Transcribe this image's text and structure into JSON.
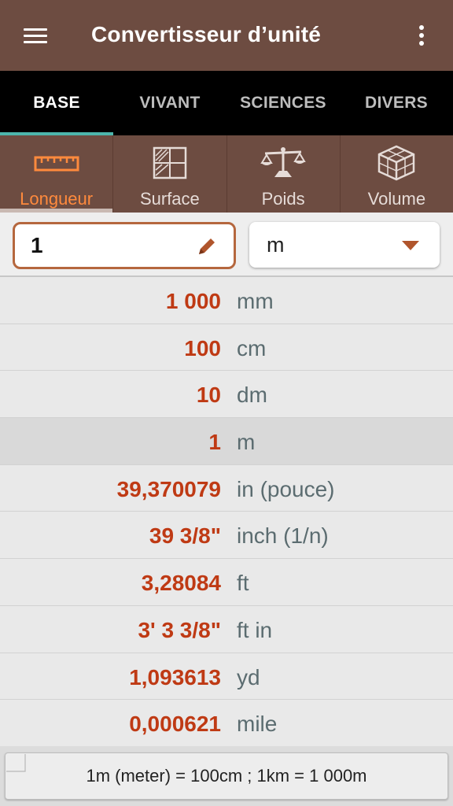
{
  "app": {
    "title": "Convertisseur d’unité",
    "icons": {
      "menu": "hamburger-menu-icon",
      "more": "more-vert-icon"
    }
  },
  "tabs": [
    {
      "label": "BASE",
      "active": true
    },
    {
      "label": "VIVANT",
      "active": false
    },
    {
      "label": "SCIENCES",
      "active": false
    },
    {
      "label": "DIVERS",
      "active": false
    }
  ],
  "categories": [
    {
      "label": "Longueur",
      "icon": "ruler-icon",
      "active": true
    },
    {
      "label": "Surface",
      "icon": "surface-grid-icon",
      "active": false
    },
    {
      "label": "Poids",
      "icon": "scale-icon",
      "active": false
    },
    {
      "label": "Volume",
      "icon": "cube-icon",
      "active": false
    }
  ],
  "input": {
    "value": "1",
    "edit_icon": "pencil-icon",
    "unit": "m",
    "unit_icon": "dropdown-caret-icon"
  },
  "results": [
    {
      "value": "1 000",
      "unit": "mm"
    },
    {
      "value": "100",
      "unit": "cm"
    },
    {
      "value": "10",
      "unit": "dm"
    },
    {
      "value": "1",
      "unit": "m",
      "selected": true
    },
    {
      "value": "39,370079",
      "unit": "in (pouce)"
    },
    {
      "value": "39 3/8\"",
      "unit": "inch (1/n)"
    },
    {
      "value": "3,28084",
      "unit": "ft"
    },
    {
      "value": "3' 3 3/8\"",
      "unit": "ft in"
    },
    {
      "value": "1,093613",
      "unit": "yd"
    },
    {
      "value": "0,000621",
      "unit": "mile"
    }
  ],
  "footer": {
    "text": "1m (meter) = 100cm ; 1km = 1 000m"
  },
  "colors": {
    "toolbar": "#6d4c41",
    "tab_bar": "#000000",
    "tab_indicator": "#4db6ac",
    "active_category": "#ff8a3d",
    "value_text": "#bf3a14",
    "unit_text": "#5b6c70",
    "input_border": "#b5673e"
  }
}
